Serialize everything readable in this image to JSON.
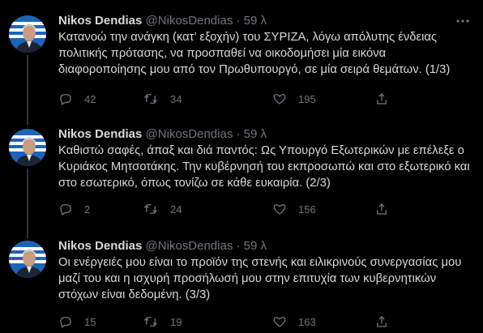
{
  "colors": {
    "background": "#000000",
    "text": "#d9d9d9",
    "secondary": "#6e767d",
    "divider": "#2f3336"
  },
  "tweets": [
    {
      "author": "Nikos Dendias",
      "handle": "@NikosDendias",
      "separator": "·",
      "time": "59 λ",
      "text": "Κατανοώ την ανάγκη (κατ’ εξοχήν) του ΣΥΡΙΖΑ, λόγω απόλυτης ένδειας πολιτικής πρότασης, να προσπαθεί να οικοδομήσει μία εικόνα διαφοροποίησης μου από τον Πρωθυπουργό, σε μία σειρά θεμάτων. (1/3)",
      "replies": "42",
      "retweets": "34",
      "likes": "195"
    },
    {
      "author": "Nikos Dendias",
      "handle": "@NikosDendias",
      "separator": "·",
      "time": "59 λ",
      "text": "Καθιστώ σαφές, άπαξ και διά παντός: Ως Υπουργό Εξωτερικών με επέλεξε ο Κυριάκος Μητσοτάκης. Την κυβέρνησή του εκπροσωπώ και στο εξωτερικό και στο εσωτερικό, όπως τονίζω σε κάθε ευκαιρία. (2/3)",
      "replies": "2",
      "retweets": "24",
      "likes": "156"
    },
    {
      "author": "Nikos Dendias",
      "handle": "@NikosDendias",
      "separator": "·",
      "time": "59 λ",
      "text": "Οι ενέργειές μου είναι το προϊόν της στενής και ειλικρινούς συνεργασίας μου μαζί του και η ισχυρή προσήλωσή μου στην επιτυχία των κυβερνητικών στόχων είναι δεδομένη. (3/3)",
      "replies": "15",
      "retweets": "19",
      "likes": "163"
    }
  ]
}
